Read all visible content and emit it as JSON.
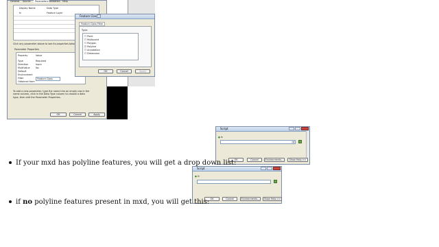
{
  "top_screenshot": {
    "tabs": [
      "General",
      "Source",
      "Parameters",
      "Validation",
      "Help"
    ],
    "columns": [
      "Display Name",
      "Data Type"
    ],
    "row": {
      "name": "fc",
      "type": "Feature Layer"
    },
    "hint": "Click any parameter above to see its properties below.",
    "properties_title": "Parameter Properties",
    "properties_headers": [
      "Property",
      "Value"
    ],
    "properties": [
      {
        "property": "Type",
        "value": "Required"
      },
      {
        "property": "Direction",
        "value": "Input"
      },
      {
        "property": "MultiValue",
        "value": "No"
      },
      {
        "property": "Default",
        "value": ""
      },
      {
        "property": "Environment",
        "value": ""
      },
      {
        "property": "Filter",
        "value": "Feature Class"
      },
      {
        "property": "Obtained from",
        "value": ""
      }
    ],
    "help_text": "To add a new parameter, type the name into an empty row in the name column, click in the Data Type column to choose a data type, then edit the Parameter Properties.",
    "buttons": {
      "ok": "OK",
      "cancel": "Cancel",
      "apply": "Apply"
    }
  },
  "filter_dialog": {
    "title": "Feature Class",
    "tab": "Feature Class Filter",
    "group_label": "Type:",
    "types": [
      {
        "label": "Point",
        "checked": false
      },
      {
        "label": "Multipoint",
        "checked": false
      },
      {
        "label": "Polygon",
        "checked": false
      },
      {
        "label": "Polyline",
        "checked": true
      },
      {
        "label": "Annotation",
        "checked": false
      },
      {
        "label": "Dimension",
        "checked": false
      }
    ],
    "buttons": {
      "ok": "OK",
      "cancel": "Cancel",
      "apply": "Apply"
    }
  },
  "script_dialog_1": {
    "title": "Script",
    "param_label": "fc",
    "buttons": {
      "ok": "OK",
      "cancel": "Cancel",
      "environments": "Environments...",
      "help": "Show Help >>"
    }
  },
  "script_dialog_2": {
    "title": "Script",
    "param_label": "fc",
    "buttons": {
      "ok": "OK",
      "cancel": "Cancel",
      "environments": "Environments...",
      "help": "Show Help >>"
    }
  },
  "bullets": {
    "first": "If your mxd has polyline features, you will get a drop down list:",
    "second_prefix": "if ",
    "second_bold": "no",
    "second_suffix": " polyline features present in mxd, you will get this:"
  }
}
